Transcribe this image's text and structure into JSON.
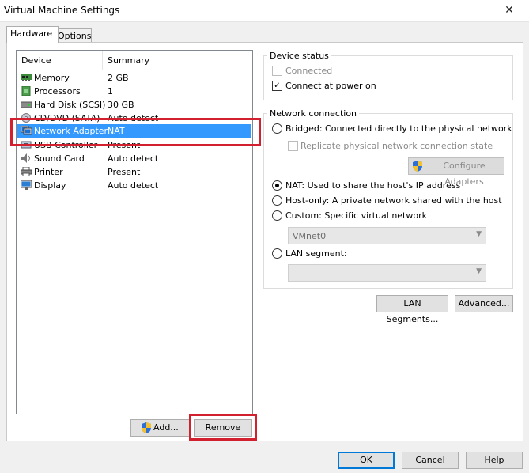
{
  "window": {
    "title": "Virtual Machine Settings",
    "close_glyph": "✕"
  },
  "tabs": [
    {
      "label": "Hardware"
    },
    {
      "label": "Options"
    }
  ],
  "device_list": {
    "headers": {
      "device": "Device",
      "summary": "Summary"
    },
    "rows": [
      {
        "name": "Memory",
        "summary": "2 GB",
        "icon": "memory-icon"
      },
      {
        "name": "Processors",
        "summary": "1",
        "icon": "processor-icon"
      },
      {
        "name": "Hard Disk (SCSI)",
        "summary": "30 GB",
        "icon": "hard-disk-icon"
      },
      {
        "name": "CD/DVD (SATA)",
        "summary": "Auto detect",
        "icon": "cd-dvd-icon"
      },
      {
        "name": "Network Adapter",
        "summary": "NAT",
        "icon": "network-adapter-icon",
        "selected": true
      },
      {
        "name": "USB Controller",
        "summary": "Present",
        "icon": "usb-icon"
      },
      {
        "name": "Sound Card",
        "summary": "Auto detect",
        "icon": "sound-card-icon"
      },
      {
        "name": "Printer",
        "summary": "Present",
        "icon": "printer-icon"
      },
      {
        "name": "Display",
        "summary": "Auto detect",
        "icon": "display-icon"
      }
    ]
  },
  "buttons": {
    "add": "Add...",
    "remove": "Remove",
    "ok": "OK",
    "cancel": "Cancel",
    "help": "Help",
    "lan_segments": "LAN Segments...",
    "advanced": "Advanced...",
    "configure_adapters": "Configure Adapters"
  },
  "device_status": {
    "label": "Device status",
    "connected": {
      "label": "Connected",
      "checked": false,
      "enabled": false
    },
    "connect_at_power_on": {
      "label": "Connect at power on",
      "checked": true
    }
  },
  "network_connection": {
    "label": "Network connection",
    "bridged": "Bridged: Connected directly to the physical network",
    "replicate": "Replicate physical network connection state",
    "nat": "NAT: Used to share the host's IP address",
    "host_only": "Host-only: A private network shared with the host",
    "custom": "Custom: Specific virtual network",
    "vmnet_value": "VMnet0",
    "lan_segment": "LAN segment:",
    "lan_segment_value": "",
    "selected": "nat"
  },
  "colors": {
    "selection": "#3399ff",
    "highlight_box": "#d2202e",
    "accent": "#0078d7"
  }
}
